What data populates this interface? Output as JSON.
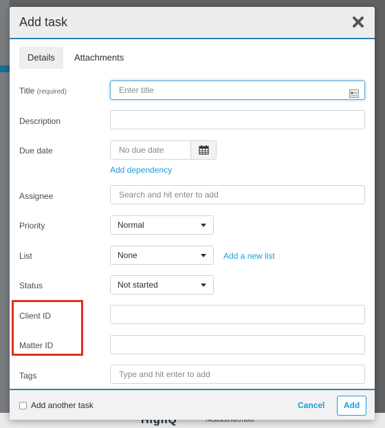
{
  "dialog": {
    "title": "Add task",
    "close_icon": "close-icon"
  },
  "tabs": [
    {
      "label": "Details",
      "active": true
    },
    {
      "label": "Attachments",
      "active": false
    }
  ],
  "fields": {
    "title": {
      "label": "Title",
      "label_note": "(required)",
      "placeholder": "Enter title"
    },
    "description": {
      "label": "Description",
      "value": ""
    },
    "due_date": {
      "label": "Due date",
      "placeholder": "No due date",
      "dependency_link": "Add dependency"
    },
    "assignee": {
      "label": "Assignee",
      "placeholder": "Search and hit enter to add"
    },
    "priority": {
      "label": "Priority",
      "selected": "Normal"
    },
    "list": {
      "label": "List",
      "selected": "None",
      "add_link": "Add a new list"
    },
    "status": {
      "label": "Status",
      "selected": "Not started"
    },
    "client_id": {
      "label": "Client ID",
      "value": ""
    },
    "matter_id": {
      "label": "Matter ID",
      "value": ""
    },
    "tags": {
      "label": "Tags",
      "placeholder": "Type and hit enter to add"
    }
  },
  "footer": {
    "add_another_label": "Add another task",
    "add_another_checked": false,
    "cancel_label": "Cancel",
    "add_label": "Add"
  },
  "colors": {
    "accent": "#1a9bd7",
    "header_rule": "#2e7fb0",
    "highlight_box": "#d93320"
  }
}
